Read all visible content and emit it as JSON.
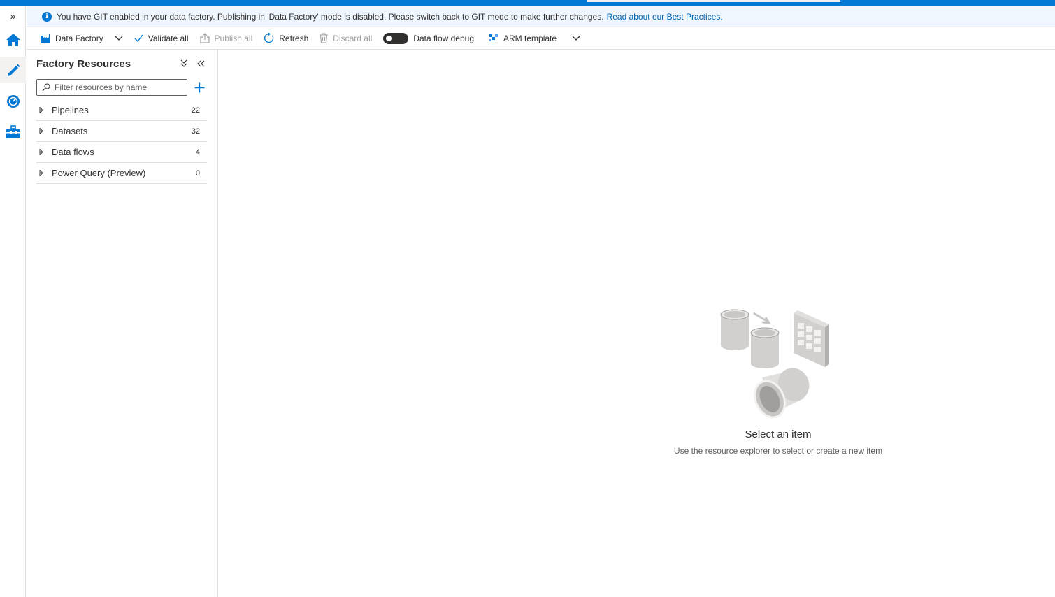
{
  "banner": {
    "message": "You have GIT enabled in your data factory. Publishing in 'Data Factory' mode is disabled. Please switch back to GIT mode to make further changes.",
    "link": "Read about our Best Practices."
  },
  "toolbar": {
    "factory_label": "Data Factory",
    "validate_label": "Validate all",
    "publish_label": "Publish all",
    "refresh_label": "Refresh",
    "discard_label": "Discard all",
    "debug_label": "Data flow debug",
    "arm_label": "ARM template"
  },
  "panel": {
    "title": "Factory Resources",
    "search_placeholder": "Filter resources by name",
    "items": [
      {
        "label": "Pipelines",
        "count": "22"
      },
      {
        "label": "Datasets",
        "count": "32"
      },
      {
        "label": "Data flows",
        "count": "4"
      },
      {
        "label": "Power Query (Preview)",
        "count": "0"
      }
    ]
  },
  "empty_state": {
    "title": "Select an item",
    "subtitle": "Use the resource explorer to select or create a new item"
  },
  "colors": {
    "accent": "#0078d4",
    "banner_bg": "#f0f6ff",
    "link": "#0062ad"
  },
  "nav_icons": [
    "home-icon",
    "author-pencil-icon",
    "monitor-icon",
    "manage-toolbox-icon"
  ]
}
